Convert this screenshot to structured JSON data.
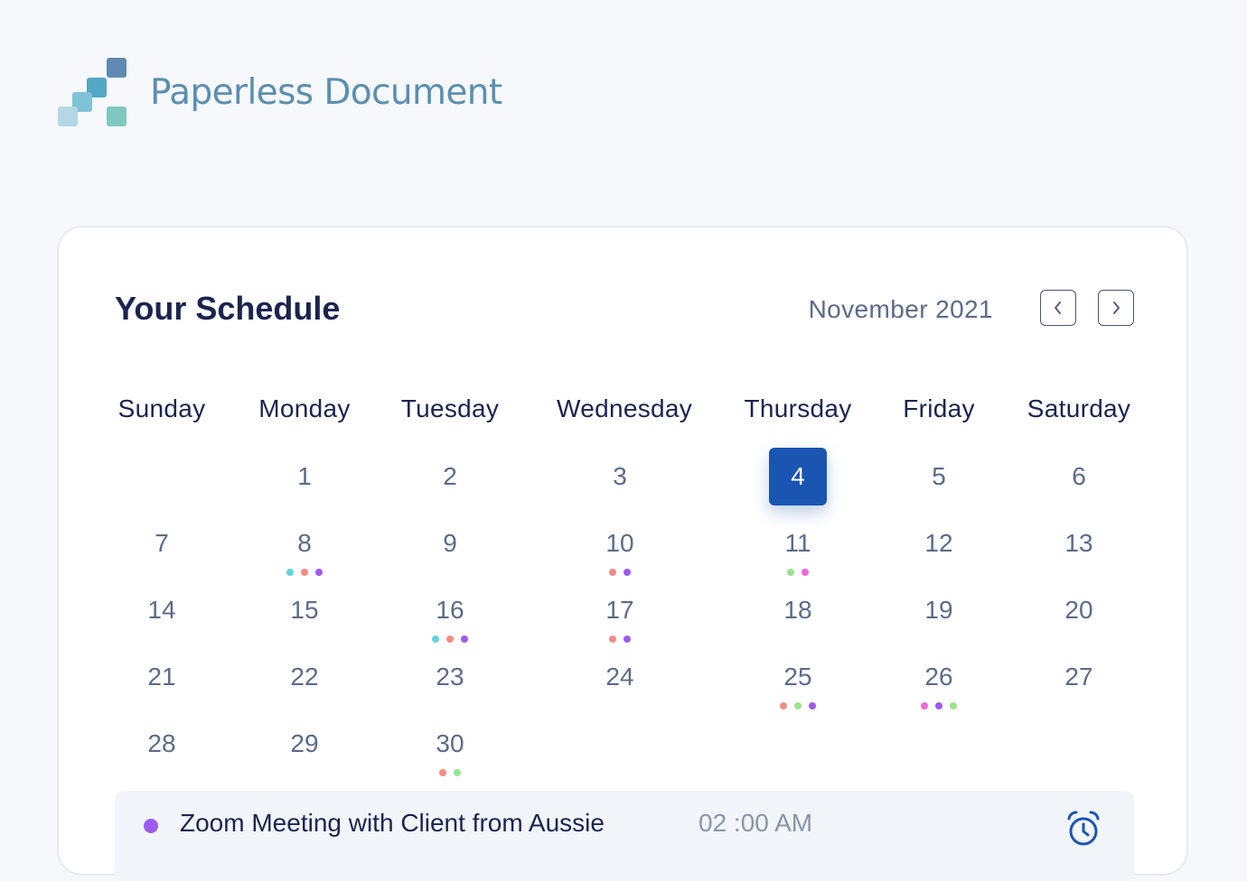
{
  "brand": {
    "name": "Paperless Document",
    "logo_colors": [
      "#5f8ab2",
      "#52a7c5",
      "#80c2d6",
      "#b3d7e4",
      "#7fc8c2"
    ]
  },
  "schedule": {
    "title": "Your Schedule",
    "month_label": "November 2021",
    "weekdays": [
      "Sunday",
      "Monday",
      "Tuesday",
      "Wednesday",
      "Thursday",
      "Friday",
      "Saturday"
    ],
    "selected_day": "4",
    "weeks": [
      [
        {
          "day": ""
        },
        {
          "day": "1",
          "dots": []
        },
        {
          "day": "2",
          "dots": []
        },
        {
          "day": "3",
          "dots": []
        },
        {
          "day": "4",
          "dots": []
        },
        {
          "day": "5",
          "dots": []
        },
        {
          "day": "6",
          "dots": []
        }
      ],
      [
        {
          "day": "7",
          "dots": []
        },
        {
          "day": "8",
          "dots": [
            "#63d1df",
            "#f38c86",
            "#9d5cf0"
          ]
        },
        {
          "day": "9",
          "dots": []
        },
        {
          "day": "10",
          "dots": [
            "#f38c86",
            "#9d5cf0"
          ]
        },
        {
          "day": "11",
          "dots": [
            "#97e58d",
            "#f268d9"
          ]
        },
        {
          "day": "12",
          "dots": []
        },
        {
          "day": "13",
          "dots": []
        }
      ],
      [
        {
          "day": "14",
          "dots": []
        },
        {
          "day": "15",
          "dots": []
        },
        {
          "day": "16",
          "dots": [
            "#63d1df",
            "#f38c86",
            "#9d5cf0"
          ]
        },
        {
          "day": "17",
          "dots": [
            "#f38c86",
            "#9d5cf0"
          ]
        },
        {
          "day": "18",
          "dots": []
        },
        {
          "day": "19",
          "dots": []
        },
        {
          "day": "20",
          "dots": []
        }
      ],
      [
        {
          "day": "21",
          "dots": []
        },
        {
          "day": "22",
          "dots": []
        },
        {
          "day": "23",
          "dots": []
        },
        {
          "day": "24",
          "dots": []
        },
        {
          "day": "25",
          "dots": [
            "#f38c86",
            "#97e58d",
            "#9d5cf0"
          ]
        },
        {
          "day": "26",
          "dots": [
            "#f268d9",
            "#9d5cf0",
            "#97e58d"
          ]
        },
        {
          "day": "27",
          "dots": []
        }
      ],
      [
        {
          "day": "28",
          "dots": []
        },
        {
          "day": "29",
          "dots": []
        },
        {
          "day": "30",
          "dots": [
            "#f38c86",
            "#97e58d"
          ]
        },
        {
          "day": ""
        },
        {
          "day": ""
        },
        {
          "day": ""
        },
        {
          "day": ""
        }
      ]
    ],
    "event": {
      "dot_color": "#9d5cf0",
      "title": "Zoom Meeting with Client from Aussie",
      "time": "02 :00 AM",
      "icon": "alarm-clock-icon"
    }
  },
  "colors": {
    "accent": "#1b55b2",
    "heading": "#1b2450",
    "muted": "#5c6b88"
  }
}
